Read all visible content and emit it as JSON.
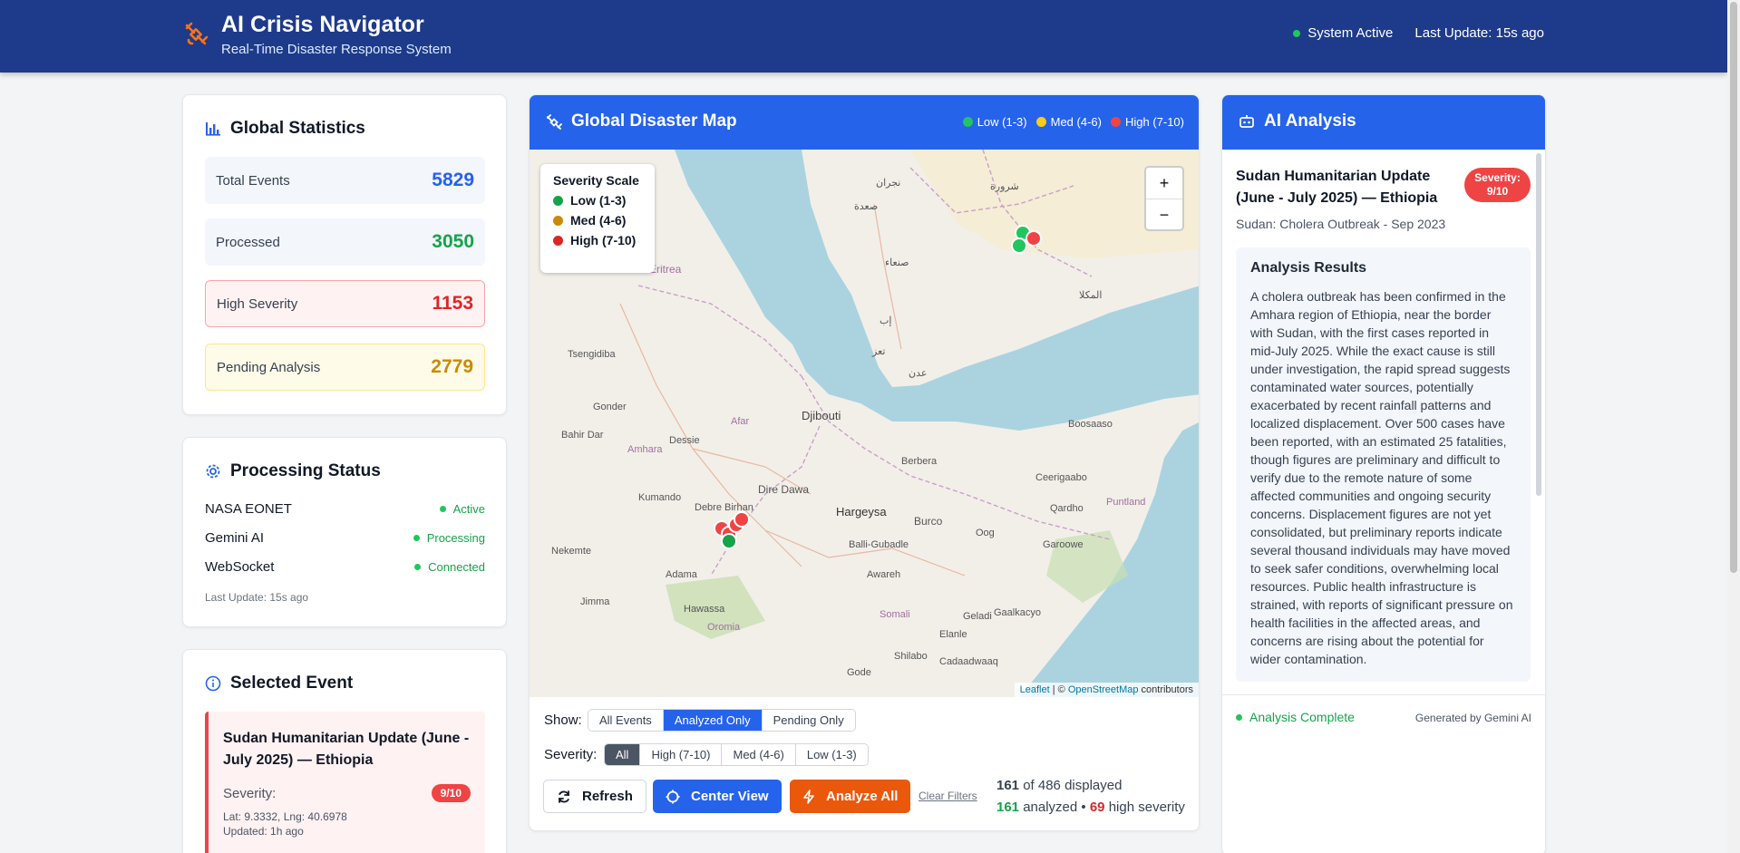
{
  "header": {
    "title": "AI Crisis Navigator",
    "subtitle": "Real-Time Disaster Response System",
    "system_status": "System Active",
    "last_update": "Last Update: 15s ago"
  },
  "global_stats": {
    "title": "Global Statistics",
    "items": [
      {
        "label": "Total Events",
        "value": "5829",
        "color": "#2563eb"
      },
      {
        "label": "Processed",
        "value": "3050",
        "color": "#16a34a"
      },
      {
        "label": "High Severity",
        "value": "1153",
        "color": "#dc2626"
      },
      {
        "label": "Pending Analysis",
        "value": "2779",
        "color": "#ca8a04"
      }
    ]
  },
  "processing": {
    "title": "Processing Status",
    "rows": [
      {
        "name": "NASA EONET",
        "status": "Active"
      },
      {
        "name": "Gemini AI",
        "status": "Processing"
      },
      {
        "name": "WebSocket",
        "status": "Connected"
      }
    ],
    "last_update": "Last Update: 15s ago"
  },
  "selected_event": {
    "title": "Selected Event",
    "event_title": "Sudan Humanitarian Update (June - July 2025) — Ethiopia",
    "severity_label": "Severity:",
    "severity_badge": "9/10",
    "coords": "Lat: 9.3332, Lng: 40.6978",
    "updated": "Updated: 1h ago"
  },
  "map": {
    "title": "Global Disaster Map",
    "legend": [
      {
        "label": "Low (1-3)",
        "color": "#22c55e"
      },
      {
        "label": "Med (4-6)",
        "color": "#facc15"
      },
      {
        "label": "High (7-10)",
        "color": "#ef4444"
      }
    ],
    "severity_scale": {
      "title": "Severity Scale",
      "items": [
        {
          "label": "Low (1-3)",
          "color": "#16a34a"
        },
        {
          "label": "Med (4-6)",
          "color": "#ca8a04"
        },
        {
          "label": "High (7-10)",
          "color": "#dc2626"
        }
      ]
    },
    "zoom_in": "+",
    "zoom_out": "−",
    "attribution_leaflet": "Leaflet",
    "attribution_sep": " | © ",
    "attribution_osm": "OpenStreetMap",
    "attribution_tail": " contributors",
    "places": [
      "Eritrea",
      "Djibouti",
      "Hargeysa",
      "Berbera",
      "Burco",
      "Dire Dawa",
      "Debre Birhan",
      "Tsengidiba",
      "Gonder",
      "Bahir Dar",
      "Dessie",
      "Adama",
      "Jimma",
      "Hawassa",
      "Nekemte",
      "Kumando",
      "Boosaaso",
      "Ceerigaabo",
      "Qardho",
      "Garoowe",
      "Oog",
      "Geladi",
      "Gaalkacyo",
      "Elanle",
      "Shilabo",
      "Cadaadwaaq",
      "Gode",
      "Awareh",
      "Balli-Gubadle",
      "Afar",
      "Amhara",
      "Oromia",
      "Somali",
      "Puntland",
      "صنعاء",
      "عدن",
      "تعز",
      "إب",
      "نجران",
      "صعدة",
      "المكلا",
      "شرورة"
    ]
  },
  "controls": {
    "show_label": "Show:",
    "show_options": [
      "All Events",
      "Analyzed Only",
      "Pending Only"
    ],
    "show_selected": 1,
    "severity_label": "Severity:",
    "severity_options": [
      "All",
      "High (7-10)",
      "Med (4-6)",
      "Low (1-3)"
    ],
    "severity_selected": 0,
    "refresh": "Refresh",
    "center_view": "Center View",
    "analyze_all": "Analyze All",
    "clear_filters": "Clear Filters",
    "displayed": "161",
    "displayed_total": " of 486 displayed",
    "analyzed": "161",
    "analyzed_text": " analyzed • ",
    "high": "69",
    "high_text": " high severity"
  },
  "ai": {
    "title": "AI Analysis",
    "event_title": "Sudan Humanitarian Update (June - July 2025) — Ethiopia",
    "severity_badge_line1": "Severity:",
    "severity_badge_line2": "9/10",
    "subtitle": "Sudan: Cholera Outbreak - Sep 2023",
    "results_title": "Analysis Results",
    "results_text": "A cholera outbreak has been confirmed in the Amhara region of Ethiopia, near the border with Sudan, with the first cases reported in mid-July 2025. While the exact cause is still under investigation, the rapid spread suggests contaminated water sources, potentially exacerbated by recent rainfall patterns and localized displacement. Over 500 cases have been reported, with an estimated 25 fatalities, though figures are preliminary and difficult to verify due to the remote nature of some affected communities and ongoing security concerns. Displacement figures are not yet consolidated, but preliminary reports indicate several thousand individuals may have moved to seek safer conditions, overwhelming local resources. Public health infrastructure is strained, with reports of significant pressure on health facilities in the affected areas, and concerns are rising about the potential for wider contamination.",
    "status": "Analysis Complete",
    "generated_by": "Generated by Gemini AI"
  }
}
